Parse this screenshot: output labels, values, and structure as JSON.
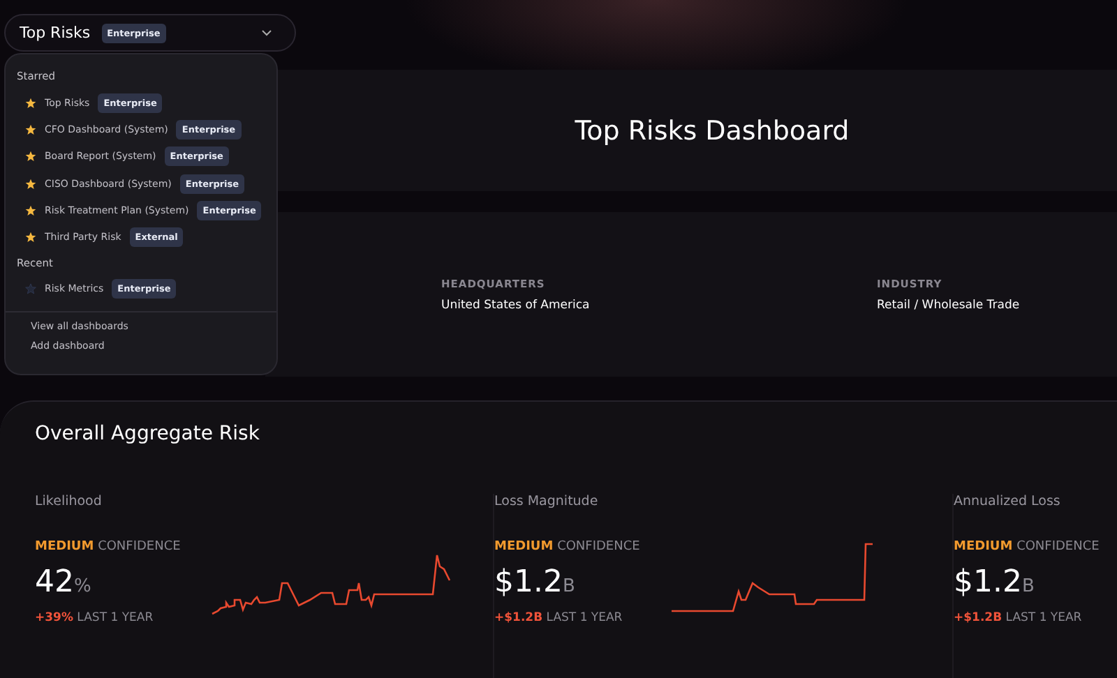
{
  "selector": {
    "title": "Top Risks",
    "badge": "Enterprise"
  },
  "dropdown": {
    "sections": [
      {
        "label": "Starred",
        "items": [
          {
            "name": "Top Risks",
            "badge": "Enterprise",
            "starred": true
          },
          {
            "name": "CFO Dashboard (System)",
            "badge": "Enterprise",
            "starred": true
          },
          {
            "name": "Board Report (System)",
            "badge": "Enterprise",
            "starred": true
          },
          {
            "name": "CISO Dashboard (System)",
            "badge": "Enterprise",
            "starred": true
          },
          {
            "name": "Risk Treatment Plan (System)",
            "badge": "Enterprise",
            "starred": true
          },
          {
            "name": "Third Party Risk",
            "badge": "External",
            "starred": true
          }
        ]
      },
      {
        "label": "Recent",
        "items": [
          {
            "name": "Risk Metrics",
            "badge": "Enterprise",
            "starred": false
          }
        ]
      }
    ],
    "actions": [
      "View all dashboards",
      "Add dashboard"
    ]
  },
  "hero": {
    "title": "Top Risks Dashboard"
  },
  "company": {
    "fields": [
      {
        "label": "HEADQUARTERS",
        "value": "United States of America"
      },
      {
        "label": "INDUSTRY",
        "value": "Retail / Wholesale Trade"
      }
    ]
  },
  "aggregate": {
    "title": "Overall Aggregate Risk",
    "metrics": [
      {
        "label": "Likelihood",
        "confidence_level": "MEDIUM",
        "confidence_word": "CONFIDENCE",
        "value": "42",
        "unit": "%",
        "change": "+39%",
        "period": "LAST 1 YEAR"
      },
      {
        "label": "Loss Magnitude",
        "confidence_level": "MEDIUM",
        "confidence_word": "CONFIDENCE",
        "value": "$1.2",
        "unit": "B",
        "change": "+$1.2B",
        "period": "LAST 1 YEAR"
      },
      {
        "label": "Annualized Loss",
        "confidence_level": "MEDIUM",
        "confidence_word": "CONFIDENCE",
        "value": "$1.2",
        "unit": "B",
        "change": "+$1.2B",
        "period": "LAST 1 YEAR"
      }
    ]
  }
}
